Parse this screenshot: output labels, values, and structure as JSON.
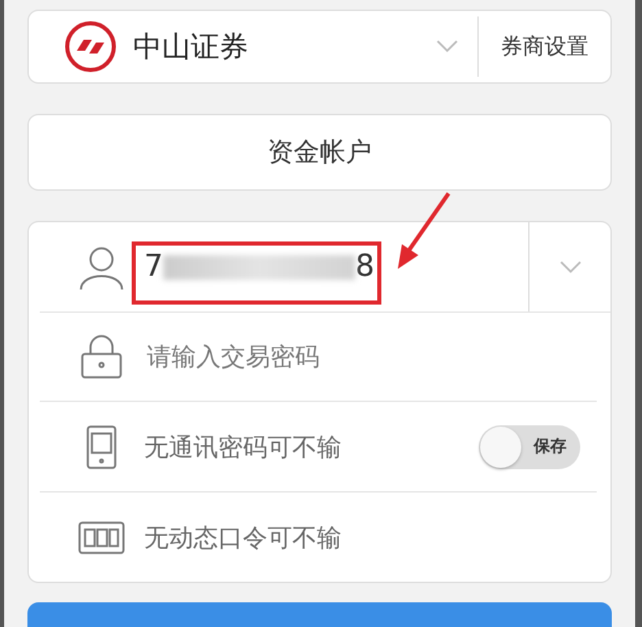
{
  "broker": {
    "name": "中山证券",
    "settings": "券商设置"
  },
  "account_type": "资金帐户",
  "account": {
    "start": "7",
    "end": "8"
  },
  "password": {
    "placeholder": "请输入交易密码"
  },
  "rows": [
    {
      "kind": "toggle",
      "label": "无通讯密码可不输",
      "toggle_label": "保存",
      "on": false
    },
    {
      "kind": "plain",
      "label": "无动态口令可不输"
    }
  ]
}
